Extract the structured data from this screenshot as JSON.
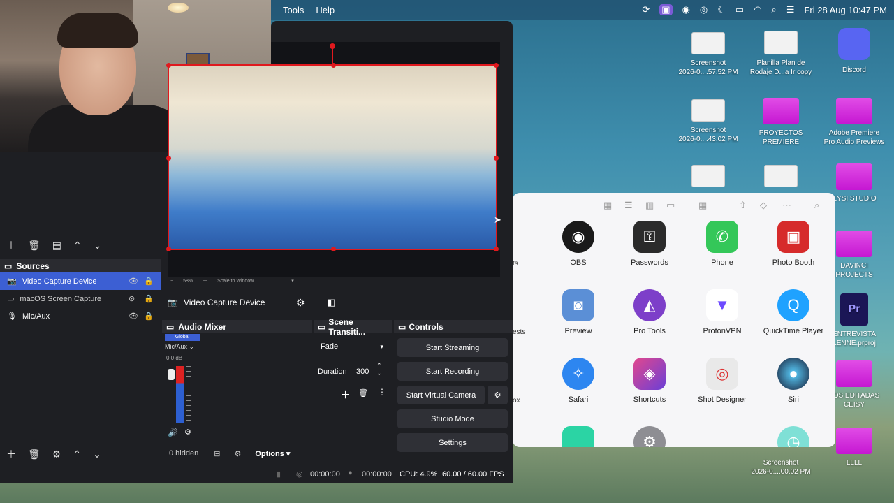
{
  "menubar": {
    "menus": [
      "Tools",
      "Help"
    ],
    "datetime": "Fri 28 Aug  10:47 PM",
    "status_icons": [
      "sync-icon",
      "screen-record-icon",
      "app-icon",
      "app-icon-2",
      "moon-icon",
      "battery-icon",
      "wifi-icon",
      "search-icon",
      "control-center-icon"
    ]
  },
  "preview": {
    "zoom": "58%",
    "scale_mode": "Scale to Window"
  },
  "sources": {
    "title": "Sources",
    "items": [
      {
        "label": "Video Capture Device",
        "icon": "camera-icon",
        "visible": true,
        "selected": true
      },
      {
        "label": "macOS Screen Capture",
        "icon": "monitor-icon",
        "visible": false,
        "selected": false
      },
      {
        "label": "Mic/Aux",
        "icon": "mic-icon",
        "visible": true,
        "selected": false
      }
    ]
  },
  "source_bar": {
    "label": "Video Capture Device"
  },
  "audio_mixer": {
    "title": "Audio Mixer",
    "tab": "Global",
    "channel": "Mic/Aux",
    "level": "0.0 dB",
    "hidden_count": "0 hidden",
    "options_label": "Options"
  },
  "scene_transitions": {
    "title": "Scene Transiti...",
    "transition": "Fade",
    "duration_label": "Duration",
    "duration_value": "300"
  },
  "controls": {
    "title": "Controls",
    "start_streaming": "Start Streaming",
    "start_recording": "Start Recording",
    "start_virtual_camera": "Start Virtual Camera",
    "studio_mode": "Studio Mode",
    "settings": "Settings"
  },
  "statusbar": {
    "stream_time": "00:00:00",
    "rec_time": "00:00:00",
    "cpu": "CPU: 4.9%",
    "fps": "60.00 / 60.00 FPS"
  },
  "launcher": {
    "apps": [
      {
        "label": "OBS",
        "color": "#1a1a1a"
      },
      {
        "label": "Passwords",
        "color": "#2b2b2b"
      },
      {
        "label": "Phone",
        "color": "#34c759"
      },
      {
        "label": "Photo Booth",
        "color": "#d62b2b"
      },
      {
        "label": "Preview",
        "color": "#5b8fd6"
      },
      {
        "label": "Pro Tools",
        "color": "#7d3fc9"
      },
      {
        "label": "ProtonVPN",
        "color": "#e9e6f7"
      },
      {
        "label": "QuickTime Player",
        "color": "#1fa2ff"
      },
      {
        "label": "Safari",
        "color": "#2d86f0"
      },
      {
        "label": "Shortcuts",
        "color": "#c33aa6"
      },
      {
        "label": "Shot Designer",
        "color": "#e9e9e9"
      },
      {
        "label": "Siri",
        "color": "#151a33"
      }
    ],
    "partial_labels": [
      "ts",
      "ests",
      "ox"
    ]
  },
  "desktop": {
    "items": [
      {
        "label": "Screenshot\n2026-0....57.52 PM",
        "kind": "thumb"
      },
      {
        "label": "Planilla Plan de\nRodaje D...a Ir copy",
        "kind": "thumb"
      },
      {
        "label": "Discord",
        "kind": "app"
      },
      {
        "label": "Screenshot\n2026-0....43.02 PM",
        "kind": "thumb"
      },
      {
        "label": "PROYECTOS\nPREMIERE",
        "kind": "folder"
      },
      {
        "label": "Adobe Premiere\nPro Audio Previews",
        "kind": "folder"
      },
      {
        "label": "EYSI STUDIO",
        "kind": "folder"
      },
      {
        "label": "DAVINCI\nPROJECTS",
        "kind": "folder"
      },
      {
        "label": "ENTREVISTA\nLENNE.prproj",
        "kind": "file"
      },
      {
        "label": "TOS EDITADAS\nCEISY",
        "kind": "folder"
      },
      {
        "label": "Screenshot\n2026-0....00.02 PM",
        "kind": "thumb"
      },
      {
        "label": "LLLL",
        "kind": "folder"
      }
    ]
  }
}
